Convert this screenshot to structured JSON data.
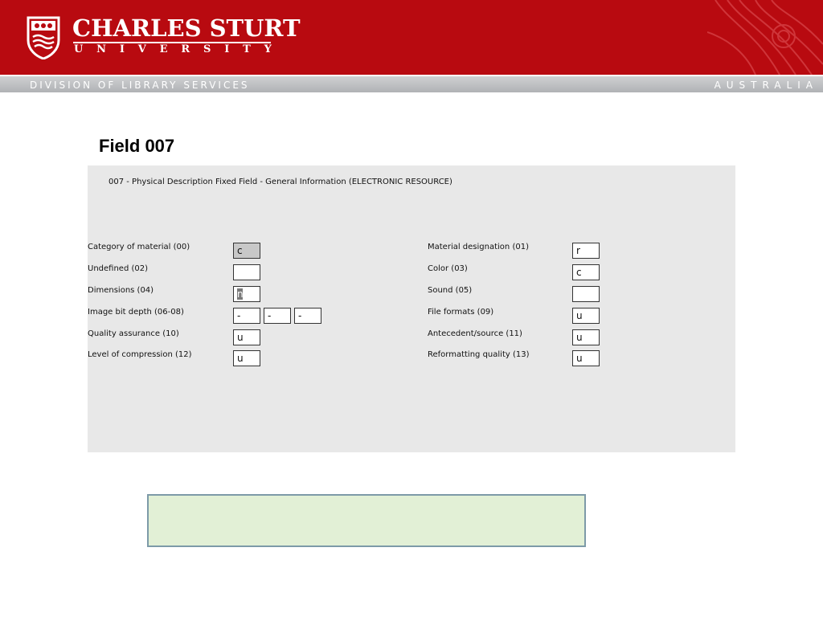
{
  "header": {
    "university_name": "CHARLES STURT",
    "university_sub": [
      "U",
      "N",
      "I",
      "V",
      "E",
      "R",
      "S",
      "I",
      "T",
      "Y"
    ],
    "division": "DIVISION OF LIBRARY SERVICES",
    "country": "AUSTRALIA",
    "brand_color": "#b80a10"
  },
  "page": {
    "title": "Field 007"
  },
  "form": {
    "heading": "007 - Physical Description Fixed Field - General Information (ELECTRONIC RESOURCE)",
    "left": [
      {
        "label": "Category of material (00)",
        "value": "c"
      },
      {
        "label": "Undefined (02)",
        "value": ""
      },
      {
        "label": "Dimensions (04)",
        "value": "n"
      },
      {
        "label": "Image bit depth (06-08)",
        "values": [
          "-",
          "-",
          "-"
        ]
      },
      {
        "label": "Quality assurance (10)",
        "value": "u"
      },
      {
        "label": "Level of compression (12)",
        "value": "u"
      }
    ],
    "right": [
      {
        "label": "Material designation (01)",
        "value": "r"
      },
      {
        "label": "Color (03)",
        "value": "c"
      },
      {
        "label": "Sound (05)",
        "value": ""
      },
      {
        "label": "File formats (09)",
        "value": "u"
      },
      {
        "label": "Antecedent/source (11)",
        "value": "u"
      },
      {
        "label": "Reformatting quality (13)",
        "value": "u"
      }
    ]
  },
  "note_box": {
    "text": ""
  }
}
